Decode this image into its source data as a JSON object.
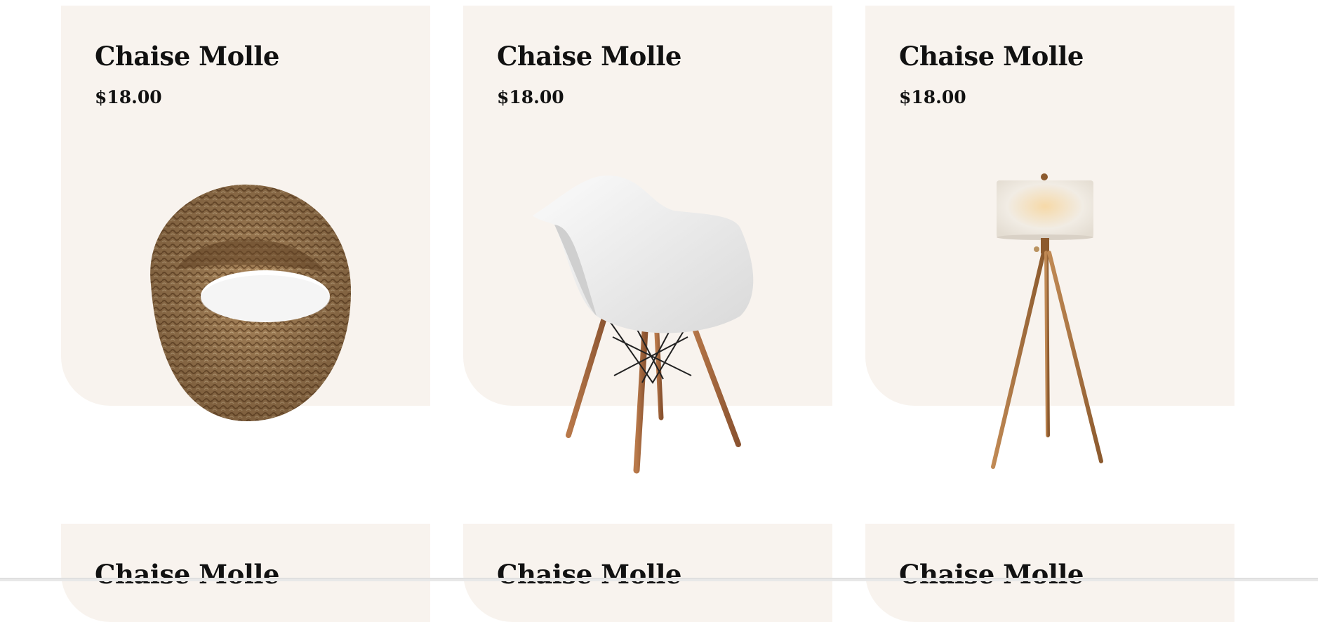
{
  "products": [
    {
      "title": "Chaise Molle",
      "price": "$18.00",
      "image": "wicker-egg-chair-image"
    },
    {
      "title": "Chaise Molle",
      "price": "$18.00",
      "image": "white-shell-armchair-image"
    },
    {
      "title": "Chaise Molle",
      "price": "$18.00",
      "image": "tripod-floor-lamp-image"
    },
    {
      "title": "Chaise Molle"
    },
    {
      "title": "Chaise Molle"
    },
    {
      "title": "Chaise Molle"
    }
  ],
  "colors": {
    "card_bg": "#f8f3ee",
    "text": "#111111",
    "page_bg": "#ffffff"
  }
}
